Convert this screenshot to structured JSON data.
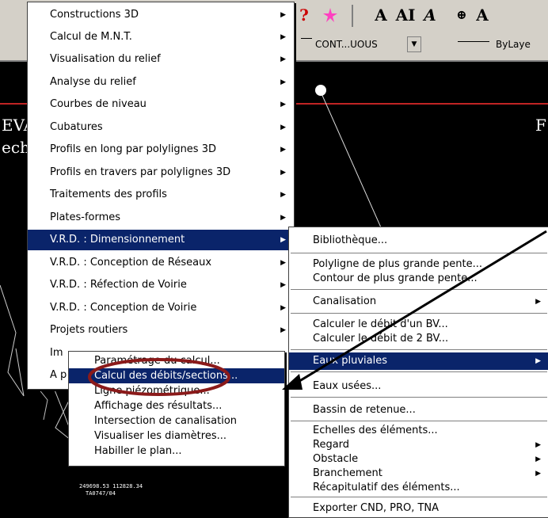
{
  "toolbar": {
    "buttons": [
      "?",
      "A",
      "AI",
      "A",
      "⊕",
      "A"
    ],
    "linetype_value": "CONT...UOUS",
    "lineweight_value": "ByLaye"
  },
  "canvas_text": {
    "left_fragment_1": "EVA",
    "left_fragment_2": "ech",
    "right_fragment": "F",
    "coord_label_1": "249698.53   112828.34",
    "coord_label_2": "TA0747/04"
  },
  "main_menu": {
    "items": [
      {
        "label": "Constructions 3D",
        "has_sub": true
      },
      {
        "label": "Calcul de M.N.T.",
        "has_sub": true
      },
      {
        "label": "Visualisation du relief",
        "has_sub": true
      },
      {
        "label": "Analyse du relief",
        "has_sub": true
      },
      {
        "label": "Courbes de niveau",
        "has_sub": true
      },
      {
        "label": "Cubatures",
        "has_sub": true
      },
      {
        "label": "Profils en long par polylignes 3D",
        "has_sub": true
      },
      {
        "label": "Profils en travers par polylignes 3D",
        "has_sub": true
      },
      {
        "label": "Traitements des profils",
        "has_sub": true
      },
      {
        "label": "Plates-formes",
        "has_sub": true
      },
      {
        "label": "V.R.D. : Dimensionnement",
        "has_sub": true
      },
      {
        "label": "V.R.D. : Conception de Réseaux",
        "has_sub": true
      },
      {
        "label": "V.R.D. : Réfection de Voirie",
        "has_sub": true
      },
      {
        "label": "V.R.D. : Conception de Voirie",
        "has_sub": true
      },
      {
        "label": "Projets routiers",
        "has_sub": true
      },
      {
        "label": "Im",
        "has_sub": false
      },
      {
        "label": "A p",
        "has_sub": false
      }
    ]
  },
  "sub_menu": {
    "items": [
      {
        "label": "Bibliothèque..."
      },
      {
        "label": "Polyligne de plus grande pente..."
      },
      {
        "label": "Contour de plus grande pente..."
      },
      {
        "label": "Canalisation",
        "has_sub": true
      },
      {
        "label": "Calculer le débit d'un BV..."
      },
      {
        "label": "Calculer le débit de 2 BV..."
      },
      {
        "label": "Eaux pluviales",
        "has_sub": true
      },
      {
        "label": "Eaux usées..."
      },
      {
        "label": "Bassin de retenue..."
      },
      {
        "label": "Echelles des éléments..."
      },
      {
        "label": "Regard",
        "has_sub": true
      },
      {
        "label": "Obstacle",
        "has_sub": true
      },
      {
        "label": "Branchement",
        "has_sub": true
      },
      {
        "label": "Récapitulatif des éléments..."
      },
      {
        "label": "Exporter CND, PRO, TNA"
      }
    ]
  },
  "sub_sub_menu": {
    "items": [
      {
        "label": "Paramétrage du calcul..."
      },
      {
        "label": "Calcul des débits/sections..."
      },
      {
        "label": "Ligne piézométrique..."
      },
      {
        "label": "Affichage des résultats..."
      },
      {
        "label": "Intersection de canalisation"
      },
      {
        "label": "Visualiser les diamètres..."
      },
      {
        "label": "Habiller le plan..."
      }
    ]
  },
  "colors": {
    "highlight": "#0a246a",
    "annotation_ellipse": "#8b1a1a",
    "annotation_arrow": "#000000"
  }
}
